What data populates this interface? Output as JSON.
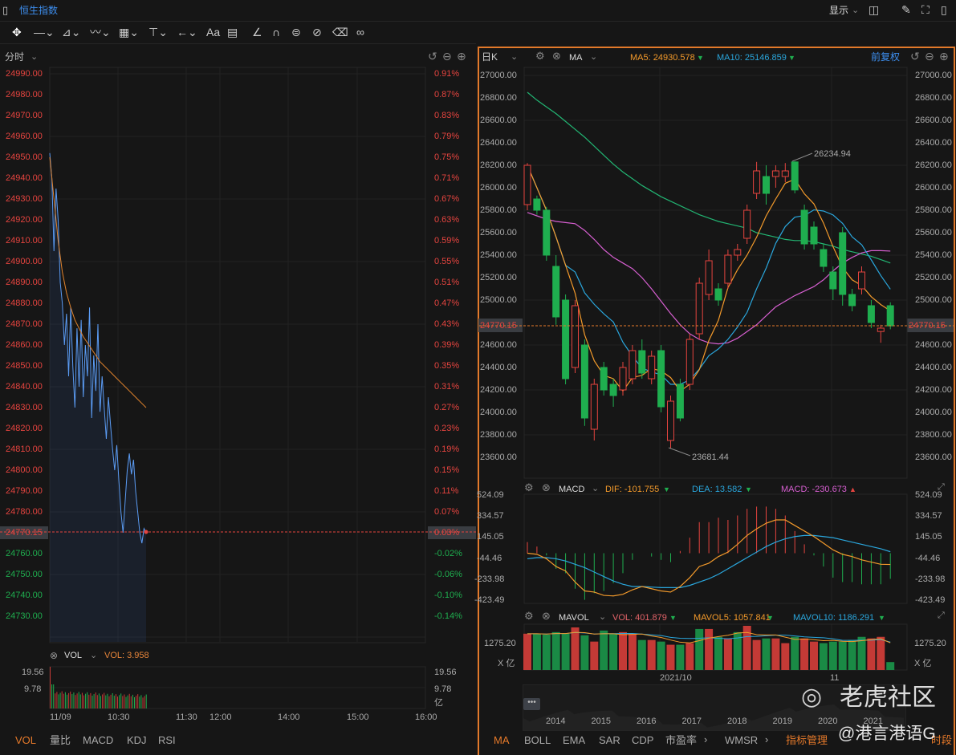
{
  "header": {
    "title": "恒生指数",
    "display_label": "显示"
  },
  "toolbar": {
    "icons": [
      "move-icon",
      "line-icon",
      "polyline-icon",
      "wave-icon",
      "fib-icon",
      "measure-icon",
      "arrow-icon",
      "text-icon",
      "comment-icon",
      "ruler-icon",
      "magnet-icon",
      "lock-icon",
      "hide-icon",
      "trash-icon",
      "overlay-icon"
    ],
    "text_label": "Aa"
  },
  "intraday": {
    "period": "分时",
    "current_price": "24770.15",
    "y_labels": [
      "24990.00",
      "24980.00",
      "24970.00",
      "24960.00",
      "24950.00",
      "24940.00",
      "24930.00",
      "24920.00",
      "24910.00",
      "24900.00",
      "24890.00",
      "24880.00",
      "24870.00",
      "24860.00",
      "24850.00",
      "24840.00",
      "24830.00",
      "24820.00",
      "24810.00",
      "24800.00",
      "24790.00",
      "24780.00",
      "24770.15",
      "24760.00",
      "24750.00",
      "24740.00",
      "24730.00"
    ],
    "pct_labels": [
      "0.91%",
      "0.87%",
      "0.83%",
      "0.79%",
      "0.75%",
      "0.71%",
      "0.67%",
      "0.63%",
      "0.59%",
      "0.55%",
      "0.51%",
      "0.47%",
      "0.43%",
      "0.39%",
      "0.35%",
      "0.31%",
      "0.27%",
      "0.23%",
      "0.19%",
      "0.15%",
      "0.11%",
      "0.07%",
      "0.03%",
      "-0.02%",
      "-0.06%",
      "-0.10%",
      "-0.14%"
    ],
    "prices": [
      24952,
      24940,
      24905,
      24935,
      24920,
      24890,
      24880,
      24860,
      24875,
      24845,
      24878,
      24850,
      24830,
      24868,
      24840,
      24872,
      24835,
      24860,
      24845,
      24878,
      24825,
      24855,
      24838,
      24870,
      24828,
      24845,
      24830,
      24815,
      24835,
      24822,
      24810,
      24800,
      24812,
      24795,
      24780,
      24770,
      24785,
      24800,
      24808,
      24798,
      24805,
      24790,
      24780,
      24770,
      24765,
      24772,
      24770
    ],
    "avg": [
      24950,
      24930,
      24910,
      24895,
      24885,
      24878,
      24872,
      24868,
      24864,
      24861,
      24858,
      24855,
      24852,
      24850,
      24848,
      24846,
      24844,
      24842,
      24840,
      24838,
      24836,
      24834,
      24832,
      24830
    ],
    "vol_label": "VOL",
    "vol_value": "VOL: 3.958",
    "vol_y": [
      "19.56",
      "9.78"
    ],
    "vol_unit": "亿",
    "time_labels": [
      "11/09",
      "10:30",
      "11:30",
      "12:00",
      "14:00",
      "15:00",
      "16:00"
    ],
    "indicator_tabs": [
      "VOL",
      "量比",
      "MACD",
      "KDJ",
      "RSI"
    ]
  },
  "kline": {
    "period": "日K",
    "overlay": "MA",
    "ma5": "MA5: 24930.578",
    "ma10": "MA10: 25146.859",
    "ma20": [
      25780,
      25750,
      25720,
      25700,
      25690,
      25680,
      25620,
      25540,
      25450,
      25380,
      25330,
      25280,
      25200,
      25100,
      24990,
      24880,
      24780,
      24700,
      24650,
      24620,
      24610,
      24620,
      24660,
      24720,
      24780,
      24860,
      24940,
      24990,
      25040,
      25080,
      25120,
      25180,
      25260,
      25330,
      25380,
      25420,
      25440,
      25440,
      25436
    ],
    "adjust": "前复权",
    "y_labels": [
      "27000.00",
      "26800.00",
      "26600.00",
      "26400.00",
      "26200.00",
      "26000.00",
      "25800.00",
      "25600.00",
      "25400.00",
      "25200.00",
      "25000.00",
      "24600.00",
      "24400.00",
      "24200.00",
      "24000.00",
      "23800.00",
      "23600.00"
    ],
    "current_price": "24770.15",
    "high_label": "26234.94",
    "low_label": "23681.44",
    "colors": {
      "up": "#e5443f",
      "down": "#1fae4f",
      "ma5": "#f39a2b",
      "ma10": "#2aa6dc",
      "ma20": "#d65fd0",
      "ma60": "#22b573"
    },
    "candles": [
      [
        25850,
        26200,
        26220,
        25800
      ],
      [
        25900,
        25800,
        25930,
        25760
      ],
      [
        25800,
        25400,
        25830,
        25350
      ],
      [
        25300,
        24850,
        25400,
        24780
      ],
      [
        25000,
        24300,
        25050,
        24250
      ],
      [
        24400,
        24950,
        25000,
        24350
      ],
      [
        24600,
        23950,
        24650,
        23880
      ],
      [
        23850,
        24250,
        24300,
        23750
      ],
      [
        24400,
        24200,
        24450,
        24150
      ],
      [
        24250,
        24150,
        24300,
        24050
      ],
      [
        24200,
        24400,
        24450,
        24150
      ],
      [
        24300,
        24550,
        24600,
        24250
      ],
      [
        24550,
        24350,
        24650,
        24300
      ],
      [
        24300,
        24500,
        24550,
        24250
      ],
      [
        24550,
        24050,
        24600,
        24000
      ],
      [
        23750,
        24100,
        24150,
        23681
      ],
      [
        24250,
        23950,
        24300,
        23920
      ],
      [
        24250,
        24650,
        24700,
        24200
      ],
      [
        24700,
        25150,
        25200,
        24650
      ],
      [
        25050,
        25350,
        25450,
        25000
      ],
      [
        25100,
        25000,
        25150,
        24950
      ],
      [
        25150,
        25400,
        25450,
        25100
      ],
      [
        25400,
        25450,
        25500,
        25350
      ],
      [
        25550,
        25800,
        25850,
        25500
      ],
      [
        25950,
        26150,
        26230,
        25900
      ],
      [
        26100,
        25950,
        26200,
        25850
      ],
      [
        26100,
        26150,
        26200,
        26000
      ],
      [
        26100,
        26150,
        26220,
        26050
      ],
      [
        26230,
        25980,
        26235,
        25950
      ],
      [
        25800,
        25500,
        25850,
        25450
      ],
      [
        25650,
        25500,
        25700,
        25450
      ],
      [
        25450,
        25300,
        25500,
        25250
      ],
      [
        25250,
        25100,
        25300,
        25000
      ],
      [
        25600,
        25050,
        25650,
        24950
      ],
      [
        25050,
        24950,
        25100,
        24900
      ],
      [
        25100,
        25250,
        25300,
        25050
      ],
      [
        24950,
        24800,
        25000,
        24750
      ],
      [
        24720,
        24750,
        24780,
        24620
      ],
      [
        24950,
        24770,
        24980,
        24740
      ]
    ],
    "ma60": [
      26850,
      26780,
      26720,
      26660,
      26590,
      26520,
      26450,
      26370,
      26290,
      26210,
      26140,
      26080,
      26020,
      25970,
      25920,
      25880,
      25840,
      25800,
      25760,
      25730,
      25700,
      25680,
      25660,
      25640,
      25600,
      25580,
      25560,
      25540,
      25530,
      25530,
      25520,
      25500,
      25480,
      25450,
      25430,
      25410,
      25390,
      25360,
      25330
    ],
    "macd": {
      "label": "MACD",
      "dif": "DIF: -101.755",
      "dea": "DEA: 13.582",
      "macd": "MACD: -230.673",
      "y_labels": [
        "524.09",
        "334.57",
        "145.05",
        "-44.46",
        "-233.98",
        "-423.49"
      ],
      "dif_values": [
        0,
        -10,
        -50,
        -120,
        -160,
        -260,
        -340,
        -350,
        -380,
        -385,
        -370,
        -330,
        -300,
        -320,
        -340,
        -350,
        -300,
        -220,
        -120,
        -90,
        -30,
        10,
        80,
        160,
        220,
        270,
        300,
        300,
        250,
        200,
        150,
        90,
        30,
        -10,
        -30,
        -60,
        -80,
        -100,
        -101.755
      ],
      "dea_values": [
        -50,
        -40,
        -40,
        -50,
        -70,
        -100,
        -130,
        -170,
        -210,
        -250,
        -280,
        -300,
        -300,
        -305,
        -310,
        -310,
        -310,
        -290,
        -260,
        -230,
        -190,
        -140,
        -90,
        -40,
        10,
        60,
        100,
        130,
        150,
        160,
        160,
        150,
        140,
        120,
        100,
        80,
        60,
        40,
        13.582
      ]
    },
    "mavol": {
      "label": "MAVOL",
      "vol": "VOL: 401.879",
      "ma5": "MAVOL5: 1057.841",
      "ma10": "MAVOL10: 1186.291",
      "y_label": "1275.20",
      "unit": "X 亿",
      "date_labels": [
        "2021/10",
        "11"
      ],
      "values": [
        1150,
        1150,
        1120,
        1200,
        1150,
        1350,
        1100,
        900,
        1250,
        1150,
        1200,
        1150,
        950,
        950,
        900,
        800,
        800,
        850,
        1300,
        1300,
        1050,
        1000,
        1200,
        1400,
        950,
        1000,
        1000,
        850,
        1050,
        1000,
        900,
        850,
        900,
        900,
        950,
        1050,
        1000,
        1050,
        250
      ],
      "up": [
        1,
        0,
        0,
        0,
        0,
        1,
        0,
        1,
        0,
        0,
        1,
        1,
        0,
        1,
        0,
        1,
        0,
        1,
        0,
        1,
        0,
        1,
        0,
        1,
        1,
        0,
        1,
        1,
        0,
        1,
        1,
        0,
        0,
        0,
        0,
        0,
        1,
        1,
        0
      ]
    },
    "overview_years": [
      "2014",
      "2015",
      "2016",
      "2017",
      "2018",
      "2019",
      "2020",
      "2021"
    ],
    "indicator_tabs": [
      "MA",
      "BOLL",
      "EMA",
      "SAR",
      "CDP",
      "市盈率",
      "WMSR",
      "指标管理",
      "时段"
    ],
    "watermark": "老虎社区",
    "author": "@港言港语G"
  }
}
